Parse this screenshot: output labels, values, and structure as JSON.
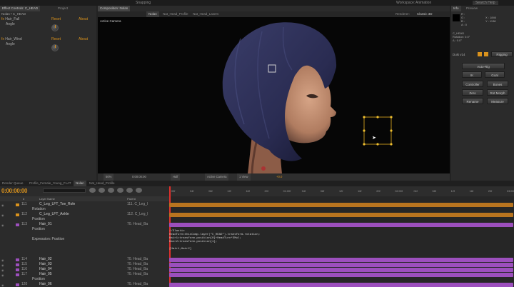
{
  "menu": [
    "Workspace:",
    "Animation",
    "Search Help"
  ],
  "toolbar": {
    "snapping": "Snapping"
  },
  "effect_panel": {
    "tab1": "Effect Controls: C_HEAD",
    "tab2": "Project",
    "title": "Nolan • C_HEAD",
    "effects": [
      {
        "name": "Hair_Fall",
        "reset": "Reset",
        "about": "About",
        "prop": "Angle"
      },
      {
        "name": "Hair_Wind",
        "reset": "Reset",
        "about": "About",
        "prop": "Angle"
      }
    ]
  },
  "comp_panel": {
    "tab_label": "Composition: Nolan",
    "sub_tabs": [
      "Nolan",
      "Nat_Head_Profile",
      "Nat_Head_Lasers"
    ],
    "renderer": "Renderer:",
    "renderer_value": "Classic 3D",
    "view_label": "Active Camera",
    "footer": {
      "zoom": "50%",
      "timecode": "0:00:00:00",
      "res": "Half",
      "camera": "Active Camera",
      "views": "1 View",
      "offset": "+0.0"
    }
  },
  "info_panel": {
    "tabs": [
      "Info",
      "Preview"
    ],
    "r": "R :",
    "g": "G :",
    "b": "B :",
    "a": "A : 0",
    "x": "X : 1846",
    "y": "Y : 1138",
    "layer": "C_HEAD",
    "rotation": "Rotation: 0.0°",
    "delta": "Δ : 0.0°"
  },
  "duik_panel": {
    "title": "Duik v14",
    "rigging": "Rigging",
    "buttons": [
      "Auto-Rig",
      "IK",
      "Goal",
      "Controller",
      "Bones",
      "Zero",
      "Rot Morph",
      "Rename",
      "Measure"
    ]
  },
  "timeline": {
    "tabs": [
      "Render Queue",
      "Profile_Female_Young_FLAT",
      "Nolan",
      "Nat_Head_Profile"
    ],
    "timecode": "0:00:00:00",
    "cols": {
      "num": "#",
      "name": "Layer Name",
      "parent": "Parent"
    },
    "rows": [
      {
        "num": "111",
        "name": "C_Leg_LFT_Toe_Role",
        "parent": "111. C_Leg_l",
        "color": "#d9921d"
      },
      {
        "num": "",
        "name": "Rotation",
        "parent": "",
        "color": ""
      },
      {
        "num": "112",
        "name": "C_Leg_LFT_Ankle",
        "parent": "112. C_Leg_l",
        "color": "#d9921d"
      },
      {
        "num": "",
        "name": "Position",
        "parent": "",
        "color": ""
      },
      {
        "num": "113",
        "name": "Hair_01",
        "parent": "70. Head_Ba",
        "color": "#9c4fbd"
      },
      {
        "num": "",
        "name": "Position",
        "parent": "",
        "color": ""
      },
      {
        "num": "",
        "name": "",
        "parent": "",
        "color": ""
      },
      {
        "num": "",
        "name": "Expression: Position",
        "parent": "",
        "color": ""
      },
      {
        "num": "",
        "name": "",
        "parent": "",
        "color": ""
      },
      {
        "num": "",
        "name": "",
        "parent": "",
        "color": ""
      },
      {
        "num": "",
        "name": "",
        "parent": "",
        "color": ""
      },
      {
        "num": "114",
        "name": "Hair_02",
        "parent": "70. Head_Ba",
        "color": "#9c4fbd"
      },
      {
        "num": "115",
        "name": "Hair_03",
        "parent": "70. Head_Ba",
        "color": "#9c4fbd"
      },
      {
        "num": "116",
        "name": "Hair_04",
        "parent": "70. Head_Ba",
        "color": "#9c4fbd"
      },
      {
        "num": "117",
        "name": "Hair_05",
        "parent": "70. Head_Ba",
        "color": "#9c4fbd"
      },
      {
        "num": "",
        "name": "Position",
        "parent": "",
        "color": ""
      },
      {
        "num": "120",
        "name": "Hair_06",
        "parent": "70. Head_Ba",
        "color": "#9c4fbd"
      }
    ],
    "ruler": [
      "00f",
      "04f",
      "08f",
      "12f",
      "16f",
      "20f",
      "01:00f",
      "04f",
      "08f",
      "12f",
      "16f",
      "20f",
      "02:00f",
      "04f",
      "08f",
      "12f",
      "16f",
      "20f",
      "03:00f"
    ],
    "expression": "//Elastic\nHeadTurn=thisComp.layer(\"C_HEAD\").transform.rotation;\nHair1=transform.position[0]+HeadTurn*5Mul;\nHair2=transform.position[1];\n\n[Hair1,Hair2]"
  },
  "colors": {
    "accent": "#d9921d",
    "purple": "#9c4fbd",
    "orange_bar": "#b8741f",
    "bg": "#232323"
  }
}
